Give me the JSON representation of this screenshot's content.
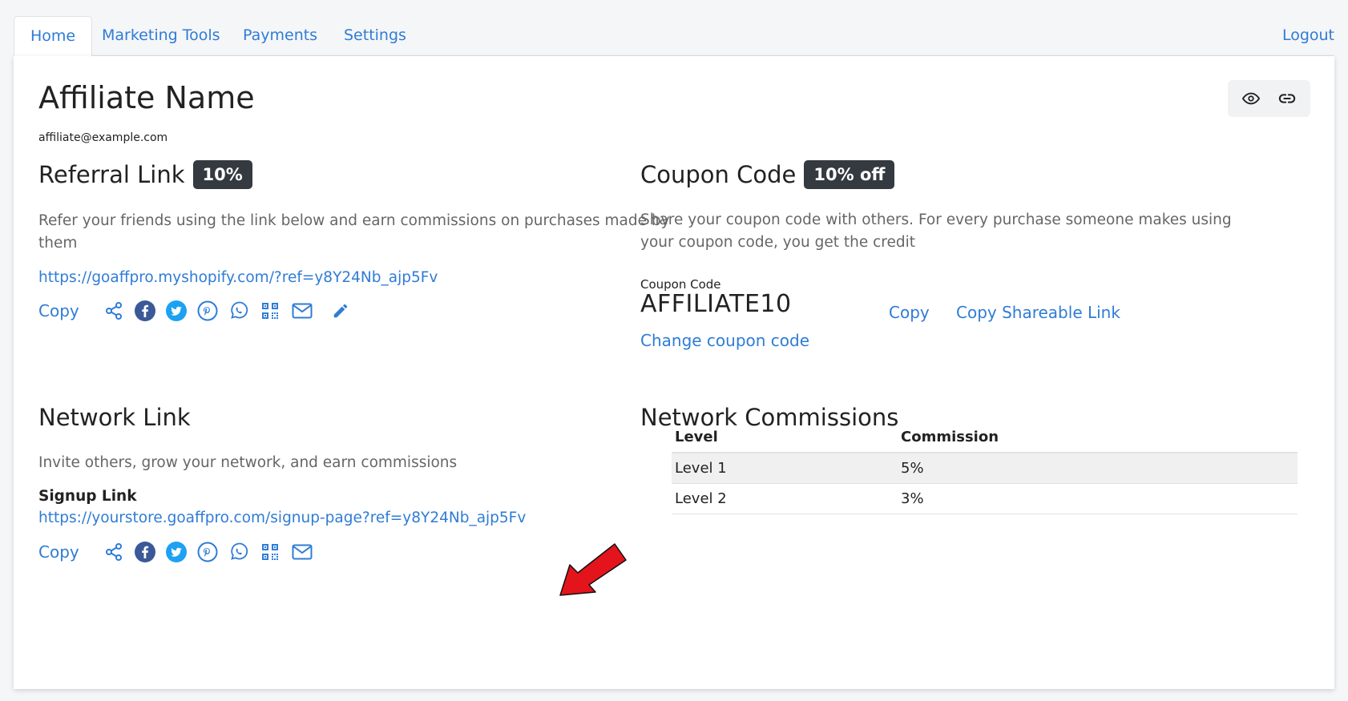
{
  "nav": {
    "tabs": [
      {
        "label": "Home"
      },
      {
        "label": "Marketing Tools"
      },
      {
        "label": "Payments"
      },
      {
        "label": "Settings"
      }
    ],
    "logout_label": "Logout"
  },
  "affiliate": {
    "name": "Affiliate Name",
    "email": "affiliate@example.com"
  },
  "top_actions": {
    "icons": [
      "eye-icon",
      "link-icon"
    ]
  },
  "referral": {
    "title": "Referral Link",
    "badge": "10%",
    "description": "Refer your friends using the link below and earn commissions on purchases made by them",
    "url": "https://goaffpro.myshopify.com/?ref=y8Y24Nb_ajp5Fv",
    "copy_label": "Copy",
    "share_icons": [
      "share-icon",
      "facebook-icon",
      "twitter-icon",
      "pinterest-icon",
      "whatsapp-icon",
      "qr-code-icon",
      "email-icon",
      "edit-icon"
    ]
  },
  "coupon": {
    "title": "Coupon Code",
    "badge": "10% off",
    "description": "Share your coupon code with others. For every purchase someone makes using your coupon code, you get the credit",
    "label": "Coupon Code",
    "code": "AFFILIATE10",
    "copy_label": "Copy",
    "copy_shareable_label": "Copy Shareable Link",
    "change_label": "Change coupon code"
  },
  "network": {
    "title": "Network Link",
    "description": "Invite others, grow your network, and earn commissions",
    "signup_label": "Signup Link",
    "url": "https://yourstore.goaffpro.com/signup-page?ref=y8Y24Nb_ajp5Fv",
    "copy_label": "Copy",
    "share_icons": [
      "share-icon",
      "facebook-icon",
      "twitter-icon",
      "pinterest-icon",
      "whatsapp-icon",
      "qr-code-icon",
      "email-icon"
    ]
  },
  "network_commissions": {
    "title": "Network Commissions",
    "headers": [
      "Level",
      "Commission"
    ],
    "rows": [
      [
        "Level 1",
        "5%"
      ],
      [
        "Level 2",
        "3%"
      ]
    ]
  },
  "colors": {
    "link": "#2f7cd6",
    "badge_bg": "#343a40",
    "arrow": "#e3141b",
    "facebook": "#3b5998",
    "twitter": "#1da1f2",
    "share_icon": "#2f7cd6"
  }
}
